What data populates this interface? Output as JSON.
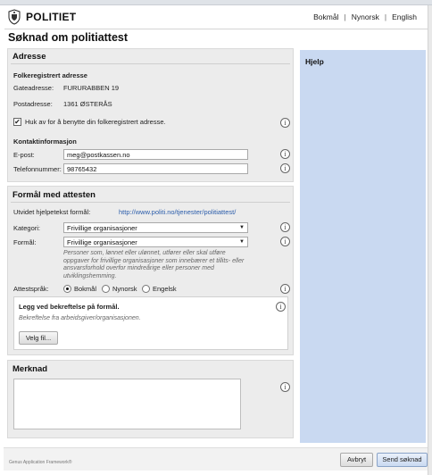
{
  "header": {
    "logo_text": "POLITIET",
    "langs": [
      "Bokmål",
      "Nynorsk",
      "English"
    ],
    "lang_sep": "|"
  },
  "page_title": "Søknad om politiattest",
  "adresse": {
    "title": "Adresse",
    "folkereg_title": "Folkeregistrert adresse",
    "gate_label": "Gateadresse:",
    "gate_value": "FURURABBEN 19",
    "post_label": "Postadresse:",
    "post_value": "1361 ØSTERÅS",
    "checkbox_label": "Huk av for å benytte din folkeregistrert adresse.",
    "checkbox_checked": true,
    "kontakt_title": "Kontaktinformasjon",
    "epost_label": "E-post:",
    "epost_value": "meg@postkassen.no",
    "tlf_label": "Telefonnummer:",
    "tlf_value": "98765432"
  },
  "formal": {
    "title": "Formål med attesten",
    "utvidet_label": "Utvidet hjelpetekst formål:",
    "utvidet_link": "http://www.politi.no/tjenester/politiattest/",
    "kategori_label": "Kategori:",
    "kategori_value": "Frivillige organisasjoner",
    "formal_label": "Formål:",
    "formal_value": "Frivillige organisasjoner",
    "formal_help": "Personer som, lønnet eller ulønnet, utfører eller skal utføre oppgaver for frivillige organisasjoner som innebærer et tillits- eller ansvarsforhold overfor mindreårige eller personer med utviklingshemming.",
    "sprak_label": "Attestspråk:",
    "sprak_options": [
      "Bokmål",
      "Nynorsk",
      "Engelsk"
    ],
    "sprak_selected": "Bokmål",
    "bekreftelse_title": "Legg ved bekreftelse på formål.",
    "bekreftelse_help": "Bekreftelse fra arbeidsgiver/organisasjonen.",
    "velg_fil": "Velg fil..."
  },
  "merknad": {
    "title": "Merknad"
  },
  "help": {
    "title": "Hjelp"
  },
  "footer": {
    "framework": "Genus Application Framework®",
    "abort": "Avbryt",
    "send": "Send søknad"
  },
  "icons": {
    "info": "info-icon",
    "check": "checkmark-icon",
    "caret": "chevron-down-icon",
    "logo": "police-crest-icon"
  },
  "colors": {
    "panel_bg": "#ececec",
    "help_bg": "#c9d9f1",
    "link": "#2a5caa"
  }
}
